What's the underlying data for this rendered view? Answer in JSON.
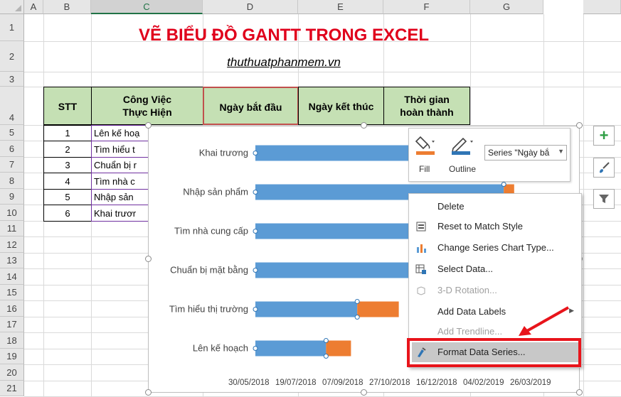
{
  "columns": [
    "A",
    "B",
    "C",
    "D",
    "E",
    "F",
    "G"
  ],
  "selected_column": "C",
  "rows": [
    "1",
    "2",
    "3",
    "4",
    "5",
    "6",
    "7",
    "8",
    "9",
    "10",
    "11",
    "12",
    "13",
    "14",
    "15",
    "16",
    "17",
    "18",
    "19",
    "20",
    "21"
  ],
  "title": "VẼ BIỂU ĐỒ GANTT TRONG EXCEL",
  "subtitle": "thuthuatphanmem.vn",
  "table": {
    "headers": {
      "stt": "STT",
      "task": "Công Việc\nThực Hiện",
      "start": "Ngày bắt đầu",
      "end": "Ngày kết thúc",
      "duration": "Thời gian\nhoàn thành"
    },
    "rows": [
      {
        "stt": "1",
        "task": "Lên kế hoạ"
      },
      {
        "stt": "2",
        "task": "Tìm hiểu t"
      },
      {
        "stt": "3",
        "task": "Chuẩn bị r"
      },
      {
        "stt": "4",
        "task": "Tìm nhà c"
      },
      {
        "stt": "5",
        "task": "Nhập sản"
      },
      {
        "stt": "6",
        "task": "Khai trươr"
      }
    ]
  },
  "chart_data": {
    "type": "bar",
    "categories": [
      "Khai trương",
      "Nhập sản phẩm",
      "Tìm nhà cung cấp",
      "Chuẩn bị mặt bằng",
      "Tìm hiểu thị trường",
      "Lên kế hoạch"
    ],
    "x_tick_labels": [
      "30/05/2018",
      "19/07/2018",
      "07/09/2018",
      "27/10/2018",
      "16/12/2018",
      "04/02/2019",
      "26/03/2019"
    ],
    "x_min": "2018-05-30",
    "x_max": "2019-04-03",
    "series": [
      {
        "values": [
          "2019-02-05",
          "2019-01-24",
          "2018-12-25",
          "2018-12-10",
          "2018-09-05",
          "2018-08-06"
        ],
        "color": "#5b9bd5"
      },
      {
        "values": [
          0,
          10,
          0,
          0,
          40,
          24
        ],
        "color": "#ed7d31"
      }
    ]
  },
  "minibar": {
    "fill_label": "Fill",
    "outline_label": "Outline",
    "series_dropdown": "Series \"Ngày bắ",
    "fill_color": "#ed7d31",
    "outline_color": "#2f75b5"
  },
  "context_menu": {
    "items": [
      {
        "label": "Delete",
        "enabled": true,
        "icon": "none"
      },
      {
        "label": "Reset to Match Style",
        "enabled": true,
        "icon": "reset-style-icon"
      },
      {
        "label": "Change Series Chart Type...",
        "enabled": true,
        "icon": "chart-type-icon"
      },
      {
        "label": "Select Data...",
        "enabled": true,
        "icon": "select-data-icon"
      },
      {
        "label": "3-D Rotation...",
        "enabled": false,
        "icon": "3d-rotation-icon"
      },
      {
        "label": "Add Data Labels",
        "enabled": true,
        "icon": "none",
        "submenu": true
      },
      {
        "label": "Add Trendline...",
        "enabled": false,
        "icon": "none"
      },
      {
        "label": "Format Data Series...",
        "enabled": true,
        "icon": "format-series-icon",
        "highlighted": true
      }
    ]
  },
  "highlight_color": "#e8141b"
}
